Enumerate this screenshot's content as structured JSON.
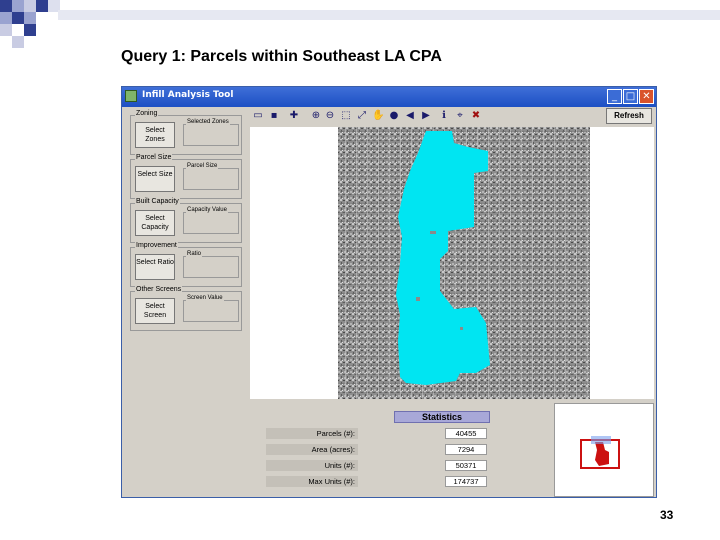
{
  "slide": {
    "title": "Query 1:  Parcels within Southeast LA CPA",
    "page_number": "33"
  },
  "window": {
    "title": "Infill Analysis Tool",
    "controls": {
      "minimize": "_",
      "maximize": "□",
      "close": "✕"
    }
  },
  "left_panel": {
    "groups": [
      {
        "label": "Zoning",
        "button": "Select Zones",
        "output_label": "Selected Zones"
      },
      {
        "label": "Parcel Size",
        "button": "Select Size",
        "output_label": "Parcel Size"
      },
      {
        "label": "Built Capacity",
        "button": "Select Capacity",
        "output_label": "Capacity Value"
      },
      {
        "label": "Improvement",
        "button": "Select Ratio",
        "output_label": "Ratio"
      },
      {
        "label": "Other Screens",
        "button": "Select Screen",
        "output_label": "Screen Value"
      }
    ]
  },
  "toolbar": {
    "refresh_label": "Refresh",
    "icons": [
      "open-icon",
      "save-icon",
      "add-layer-icon",
      "zoom-in-icon",
      "zoom-out-icon",
      "select-icon",
      "full-extent-icon",
      "pan-icon",
      "globe-icon",
      "back-icon",
      "forward-icon",
      "info-icon",
      "identify-icon",
      "clear-icon"
    ]
  },
  "statistics": {
    "title": "Statistics",
    "rows": [
      {
        "label": "Parcels (#):",
        "value": "40455"
      },
      {
        "label": "Area (acres):",
        "value": "7294"
      },
      {
        "label": "Units (#):",
        "value": "50371"
      },
      {
        "label": "Max Units (#):",
        "value": "174737"
      }
    ]
  },
  "colors": {
    "selection": "#00e5f2",
    "titlebar": "#2a5cd0",
    "overview_marker": "#cc1111",
    "squares": "#2f3f8f"
  }
}
